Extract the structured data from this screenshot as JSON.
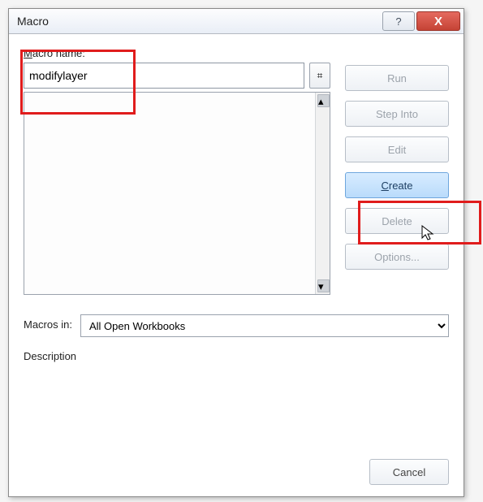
{
  "titlebar": {
    "title": "Macro"
  },
  "labels": {
    "macro_name_prefix_ul": "M",
    "macro_name_rest": "acro name:",
    "macros_in": "Macros in:",
    "description": "Description"
  },
  "inputs": {
    "macro_name_value": "modifylayer"
  },
  "dropdown": {
    "macros_in_selected": "All Open Workbooks"
  },
  "buttons": {
    "run": "Run",
    "step_into": "Step Into",
    "edit": "Edit",
    "create_prefix_ul": "C",
    "create_rest": "reate",
    "delete": "Delete",
    "options": "Options...",
    "cancel": "Cancel"
  },
  "icons": {
    "help": "?",
    "close": "X",
    "picker": "⌗"
  }
}
